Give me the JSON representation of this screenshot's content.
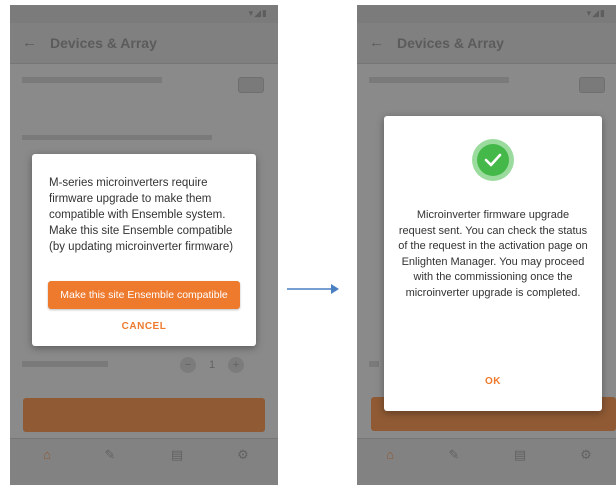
{
  "left": {
    "appbar_title": "Devices & Array",
    "dialog": {
      "message": "M-series microinverters require firmware upgrade to make them compatible with Ensemble system. Make this site Ensemble compatible (by updating microinverter firmware)",
      "primary_button": "Make this site Ensemble compatible",
      "cancel_button": "CANCEL"
    }
  },
  "right": {
    "appbar_title": "Devices & Array",
    "dialog": {
      "message": "Microinverter firmware upgrade request sent. You can check the status of the request in the activation page on Enlighten Manager. You may proceed with the commissioning once the microinverter upgrade is completed.",
      "ok_button": "OK"
    }
  },
  "colors": {
    "accent": "#ee7a2e",
    "success": "#45b84a",
    "arrow": "#4a7fc1"
  },
  "icons": [
    "back-arrow-icon",
    "checkmark-icon",
    "home-icon",
    "wrench-icon",
    "dashboard-icon",
    "gear-icon",
    "wifi-icon",
    "signal-icon",
    "battery-icon"
  ]
}
